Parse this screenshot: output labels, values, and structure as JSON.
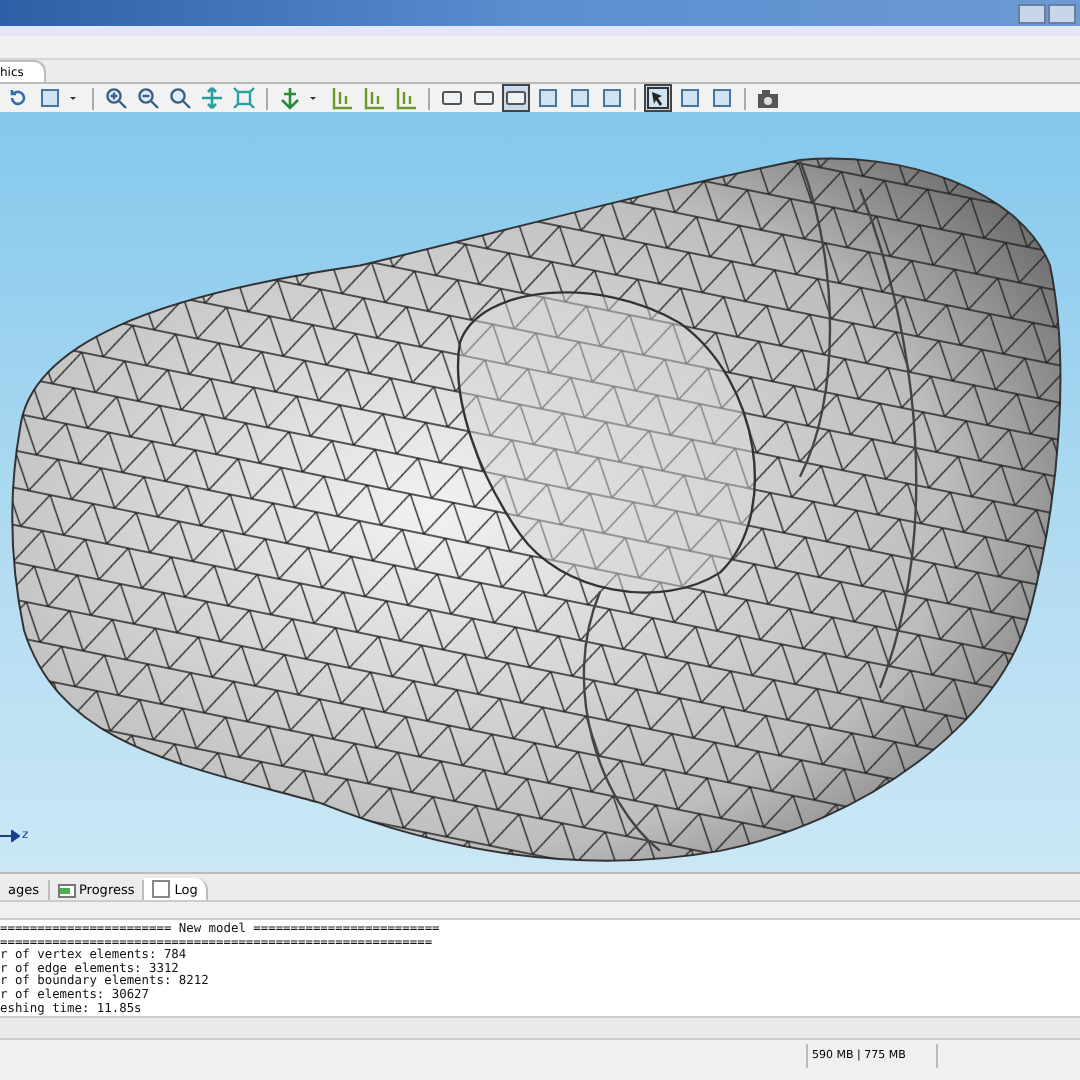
{
  "graphics_tab": {
    "label": "hics",
    "selected": true
  },
  "toolbar": [
    {
      "kind": "rotate",
      "selected": false
    },
    {
      "kind": "box",
      "selected": false
    },
    {
      "kind": "caret",
      "selected": false
    },
    {
      "kind": "sep"
    },
    {
      "kind": "zoom-in",
      "selected": false
    },
    {
      "kind": "zoom-out",
      "selected": false
    },
    {
      "kind": "zoom-box",
      "selected": false
    },
    {
      "kind": "pan",
      "selected": false
    },
    {
      "kind": "fit",
      "selected": false
    },
    {
      "kind": "sep"
    },
    {
      "kind": "axis",
      "selected": false
    },
    {
      "kind": "caret",
      "selected": false
    },
    {
      "kind": "grid",
      "selected": false
    },
    {
      "kind": "grid",
      "selected": false
    },
    {
      "kind": "grid",
      "selected": false
    },
    {
      "kind": "sep"
    },
    {
      "kind": "frame",
      "selected": false
    },
    {
      "kind": "frame",
      "selected": false
    },
    {
      "kind": "frame",
      "selected": true
    },
    {
      "kind": "box",
      "selected": false
    },
    {
      "kind": "box",
      "selected": false
    },
    {
      "kind": "box",
      "selected": false
    },
    {
      "kind": "sep"
    },
    {
      "kind": "select",
      "selected": true
    },
    {
      "kind": "box",
      "selected": false
    },
    {
      "kind": "box",
      "selected": false
    },
    {
      "kind": "sep"
    },
    {
      "kind": "camera",
      "selected": false
    }
  ],
  "axis_label": "z",
  "bottom_tabs": [
    {
      "label": "ages",
      "kind": "plain",
      "selected": false
    },
    {
      "label": "Progress",
      "kind": "progress",
      "selected": false
    },
    {
      "label": "Log",
      "kind": "log",
      "selected": true
    }
  ],
  "log_lines": [
    "======================= New model =========================",
    "==========================================================",
    "r of vertex elements: 784",
    "r of edge elements: 3312",
    "r of boundary elements: 8212",
    "r of elements: 30627",
    "eshing time: 11.85s"
  ],
  "status_bar": {
    "memory": "590 MB | 775 MB"
  }
}
